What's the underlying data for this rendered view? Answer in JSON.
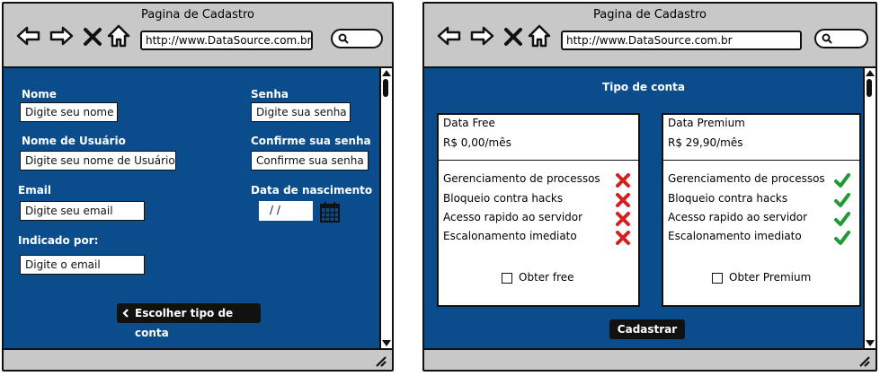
{
  "left_window": {
    "title": "Pagina de Cadastro",
    "url": "http://www.DataSource.com.br",
    "form": {
      "nome_label": "Nome",
      "nome_placeholder": "Digite seu nome",
      "usuario_label": "Nome de Usuário",
      "usuario_placeholder": "Digite seu nome de Usuário",
      "email_label": "Email",
      "email_placeholder": "Digite seu email",
      "indicado_label": "Indicado por:",
      "indicado_placeholder": "Digite o email",
      "senha_label": "Senha",
      "senha_placeholder": "Digite sua senha",
      "confirme_label": "Confirme sua senha",
      "confirme_placeholder": "Confirme sua senha",
      "nascimento_label": "Data de nascimento",
      "nascimento_value": " /  /",
      "submit_label": "Escolher tipo de conta"
    }
  },
  "right_window": {
    "title": "Pagina de Cadastro",
    "url": "http://www.DataSource.com.br",
    "heading": "Tipo de conta",
    "plans": [
      {
        "name": "Data Free",
        "price": "R$ 0,00/mês",
        "features": [
          {
            "label": "Gerenciamento de processos",
            "included": false
          },
          {
            "label": "Bloqueio contra hacks",
            "included": false
          },
          {
            "label": "Acesso rapido ao servidor",
            "included": false
          },
          {
            "label": "Escalonamento imediato",
            "included": false
          }
        ],
        "option_label": "Obter free"
      },
      {
        "name": "Data Premium",
        "price": "R$ 29,90/mês",
        "features": [
          {
            "label": "Gerenciamento de processos",
            "included": true
          },
          {
            "label": "Bloqueio contra hacks",
            "included": true
          },
          {
            "label": "Acesso rapido ao servidor",
            "included": true
          },
          {
            "label": "Escalonamento imediato",
            "included": true
          }
        ],
        "option_label": "Obter Premium"
      }
    ],
    "submit_label": "Cadastrar"
  },
  "colors": {
    "content_bg": "#0b4d8c",
    "chrome_bg": "#c8c8c8",
    "cross": "#d61f1f",
    "check": "#1f9a35"
  }
}
